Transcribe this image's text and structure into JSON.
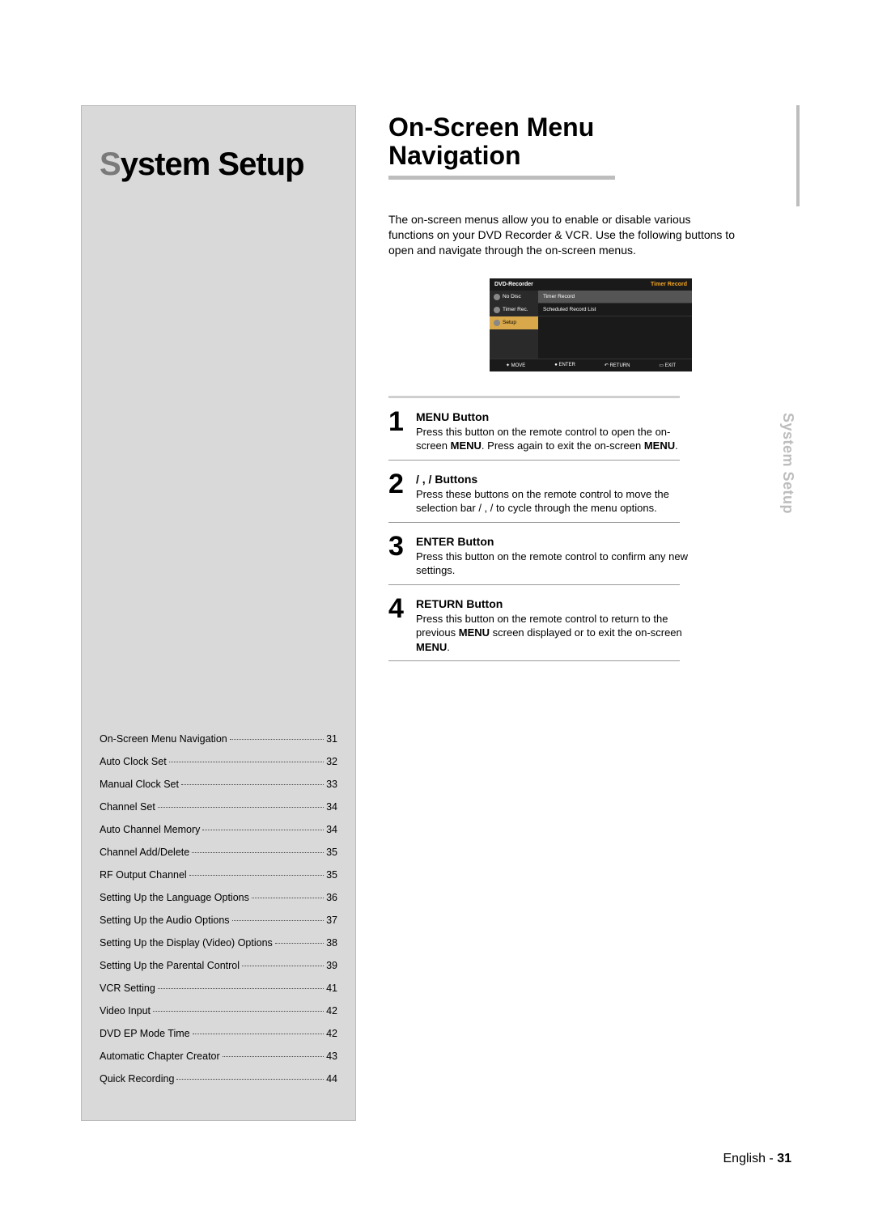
{
  "leftTitle": {
    "accent": "S",
    "rest": "ystem Setup"
  },
  "toc": [
    {
      "label": "On-Screen Menu Navigation",
      "page": "31"
    },
    {
      "label": "Auto Clock Set",
      "page": "32"
    },
    {
      "label": "Manual Clock Set",
      "page": "33"
    },
    {
      "label": "Channel Set",
      "page": "34"
    },
    {
      "label": "Auto Channel Memory",
      "page": "34"
    },
    {
      "label": "Channel Add/Delete",
      "page": "35"
    },
    {
      "label": "RF Output Channel",
      "page": "35"
    },
    {
      "label": "Setting Up the Language Options",
      "page": "36"
    },
    {
      "label": "Setting Up the Audio Options",
      "page": "37"
    },
    {
      "label": "Setting Up the Display (Video) Options",
      "page": "38"
    },
    {
      "label": "Setting Up the Parental Control",
      "page": "39"
    },
    {
      "label": "VCR Setting",
      "page": "41"
    },
    {
      "label": "Video Input",
      "page": "42"
    },
    {
      "label": "DVD EP Mode Time",
      "page": "42"
    },
    {
      "label": "Automatic Chapter Creator",
      "page": "43"
    },
    {
      "label": "Quick Recording",
      "page": "44"
    }
  ],
  "rightHeading": {
    "line1": "On-Screen Menu",
    "line2": "Navigation"
  },
  "intro": "The on-screen menus allow you to enable or disable various functions on your DVD Recorder & VCR. Use the following buttons to open and navigate through the on-screen menus.",
  "osd": {
    "headerLeft": "DVD-Recorder",
    "headerRight": "Timer Record",
    "side": [
      {
        "label": "No Disc"
      },
      {
        "label": "Timer Rec."
      },
      {
        "label": "Setup"
      }
    ],
    "main": [
      {
        "label": "Timer Record"
      },
      {
        "label": "Scheduled Record List"
      }
    ],
    "footer": {
      "move": "MOVE",
      "enter": "ENTER",
      "ret": "RETURN",
      "exit": "EXIT"
    }
  },
  "steps": [
    {
      "num": "1",
      "title": "MENU Button",
      "body_pre": "Press this button on the remote control to open the on-screen ",
      "body_bold1": "MENU",
      "body_mid": ". Press again to exit the on-screen ",
      "body_bold2": "MENU",
      "body_post": "."
    },
    {
      "num": "2",
      "title": "   /   ,   /   Buttons",
      "body_pre": "Press these buttons on the remote control to move the selection bar   /   ,   /    to cycle through the menu options.",
      "body_bold1": "",
      "body_mid": "",
      "body_bold2": "",
      "body_post": ""
    },
    {
      "num": "3",
      "title": "ENTER Button",
      "body_pre": "Press this button on the remote control to confirm any new settings.",
      "body_bold1": "",
      "body_mid": "",
      "body_bold2": "",
      "body_post": ""
    },
    {
      "num": "4",
      "title": "RETURN Button",
      "body_pre": "Press this button on the remote control to return to the previous ",
      "body_bold1": "MENU",
      "body_mid": " screen displayed or to exit the on-screen ",
      "body_bold2": "MENU",
      "body_post": "."
    }
  ],
  "sideTab": "System Setup",
  "footer": {
    "lang": "English - ",
    "page": "31"
  }
}
